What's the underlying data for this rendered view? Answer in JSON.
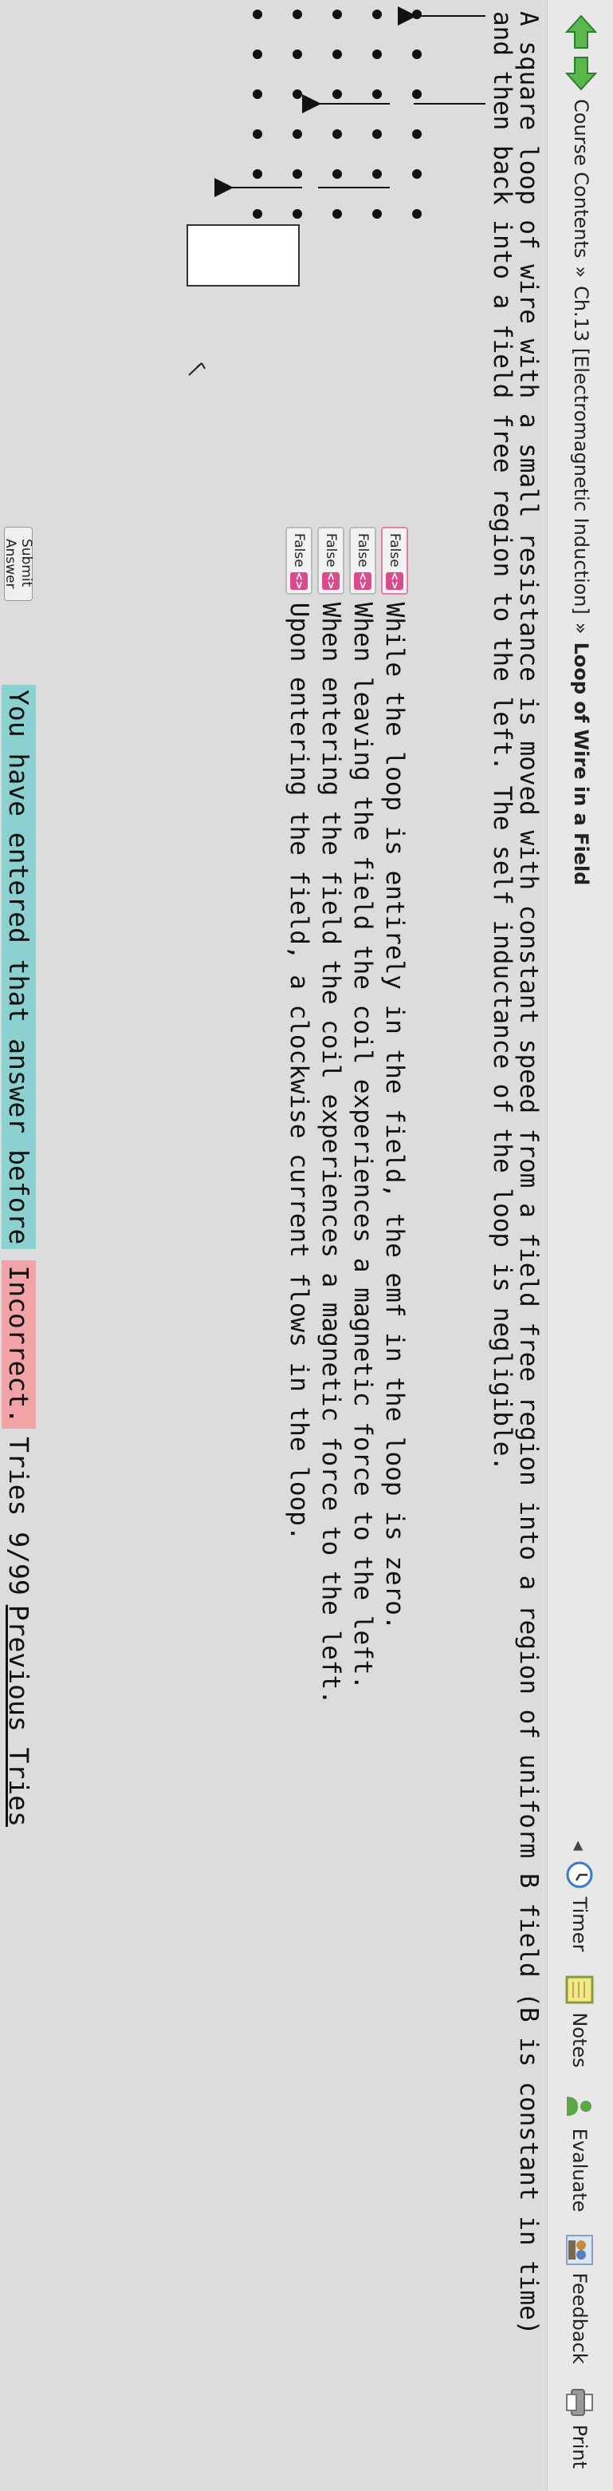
{
  "header": {
    "breadcrumb": {
      "root": "Course Contents",
      "separator1": "»",
      "chapter": "Ch.13 [Electromagnetic Induction]",
      "separator2": "»",
      "current": "Loop of Wire in a Field"
    },
    "tools": {
      "timer": "Timer",
      "notes": "Notes",
      "evaluate": "Evaluate",
      "feedback": "Feedback",
      "print": "Print"
    }
  },
  "problem": {
    "line1": "A square loop of wire with a small resistance is moved with constant speed from a field free region into a region of uniform B field (B is constant in time)",
    "line2": "and then back into a field free region to the left. The self inductance of the loop is negligible."
  },
  "statements": [
    {
      "value": "False",
      "text": "While the loop is entirely in the field, the emf in the loop is zero."
    },
    {
      "value": "False",
      "text": "When leaving the field the coil experiences a magnetic force to the left."
    },
    {
      "value": "False",
      "text": "When entering the field the coil experiences a magnetic force to the left."
    },
    {
      "value": "False",
      "text": "Upon entering the field, a clockwise current flows in the loop."
    }
  ],
  "submit": {
    "label": "Submit Answer",
    "entered_before": "You have entered that answer before",
    "status": "Incorrect.",
    "tries": "Tries 9/99",
    "previous_tries": "Previous Tries"
  },
  "colors": {
    "nav_arrow": "#4caf50",
    "select_arrow": "#d84c8e",
    "entered_bg": "#8ad1cf",
    "incorrect_bg": "#f2a3a8"
  }
}
